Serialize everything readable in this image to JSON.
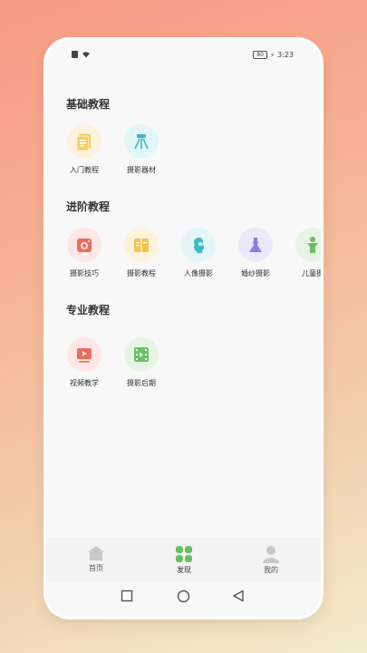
{
  "status_bar": {
    "time": "3:23",
    "battery": "80"
  },
  "sections": [
    {
      "title": "基础教程",
      "items": [
        {
          "label": "入门教程"
        },
        {
          "label": "摄影器材"
        }
      ]
    },
    {
      "title": "进阶教程",
      "items": [
        {
          "label": "摄影技巧"
        },
        {
          "label": "摄影教程"
        },
        {
          "label": "人像摄影"
        },
        {
          "label": "婚纱摄影"
        },
        {
          "label": "儿童摄"
        }
      ]
    },
    {
      "title": "专业教程",
      "items": [
        {
          "label": "视频教学"
        },
        {
          "label": "摄影后期"
        }
      ]
    }
  ],
  "tabbar": {
    "home": "首页",
    "discover": "发现",
    "mine": "我的"
  },
  "colors": {
    "accent": "#6abf63",
    "inactive": "#c9c9c9"
  }
}
